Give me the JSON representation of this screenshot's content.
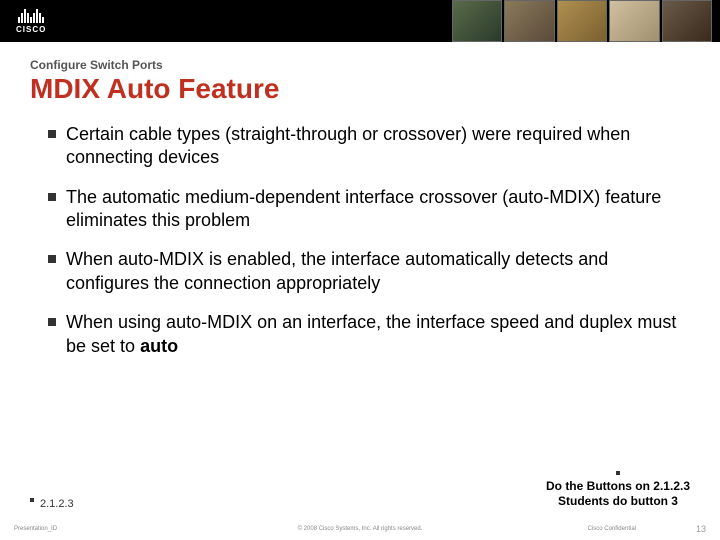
{
  "header": {
    "logo_text": "CISCO"
  },
  "slide": {
    "pretitle": "Configure Switch Ports",
    "title": "MDIX Auto Feature",
    "bullets": [
      "Certain cable types (straight-through or crossover) were required when connecting devices",
      " The automatic medium-dependent interface crossover (auto-MDIX) feature eliminates this problem",
      "When auto-MDIX is enabled, the interface automatically detects and configures the connection appropriately",
      "When using auto-MDIX on an interface, the interface speed and duplex must be set to <b>auto</b>"
    ],
    "section_ref": "2.1.2.3",
    "assignment_line1": "Do the Buttons on 2.1.2.3",
    "assignment_line2": "Students do button 3"
  },
  "footer": {
    "pres_id": "Presentation_ID",
    "copyright": "© 2008 Cisco Systems, Inc. All rights reserved.",
    "confidential": "Cisco Confidential",
    "page": "13"
  }
}
